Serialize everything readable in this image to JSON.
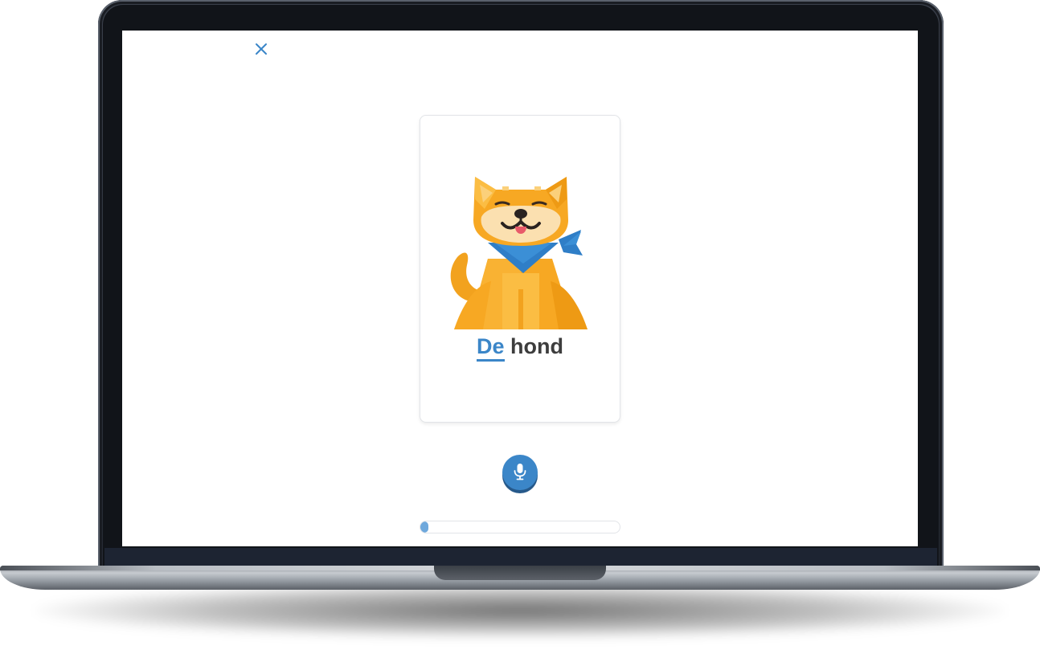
{
  "lesson": {
    "close_icon": "close-icon",
    "card": {
      "image_icon": "dog-illustration",
      "article": "De",
      "noun": "hond"
    },
    "mic_icon": "microphone-icon",
    "progress_fraction": 0.04
  },
  "colors": {
    "accent": "#3b86c8",
    "progress_fill": "#6ea8dc",
    "text": "#3d3d3d",
    "dog_orange": "#f7a823",
    "scarf_blue": "#2f7ec7"
  }
}
